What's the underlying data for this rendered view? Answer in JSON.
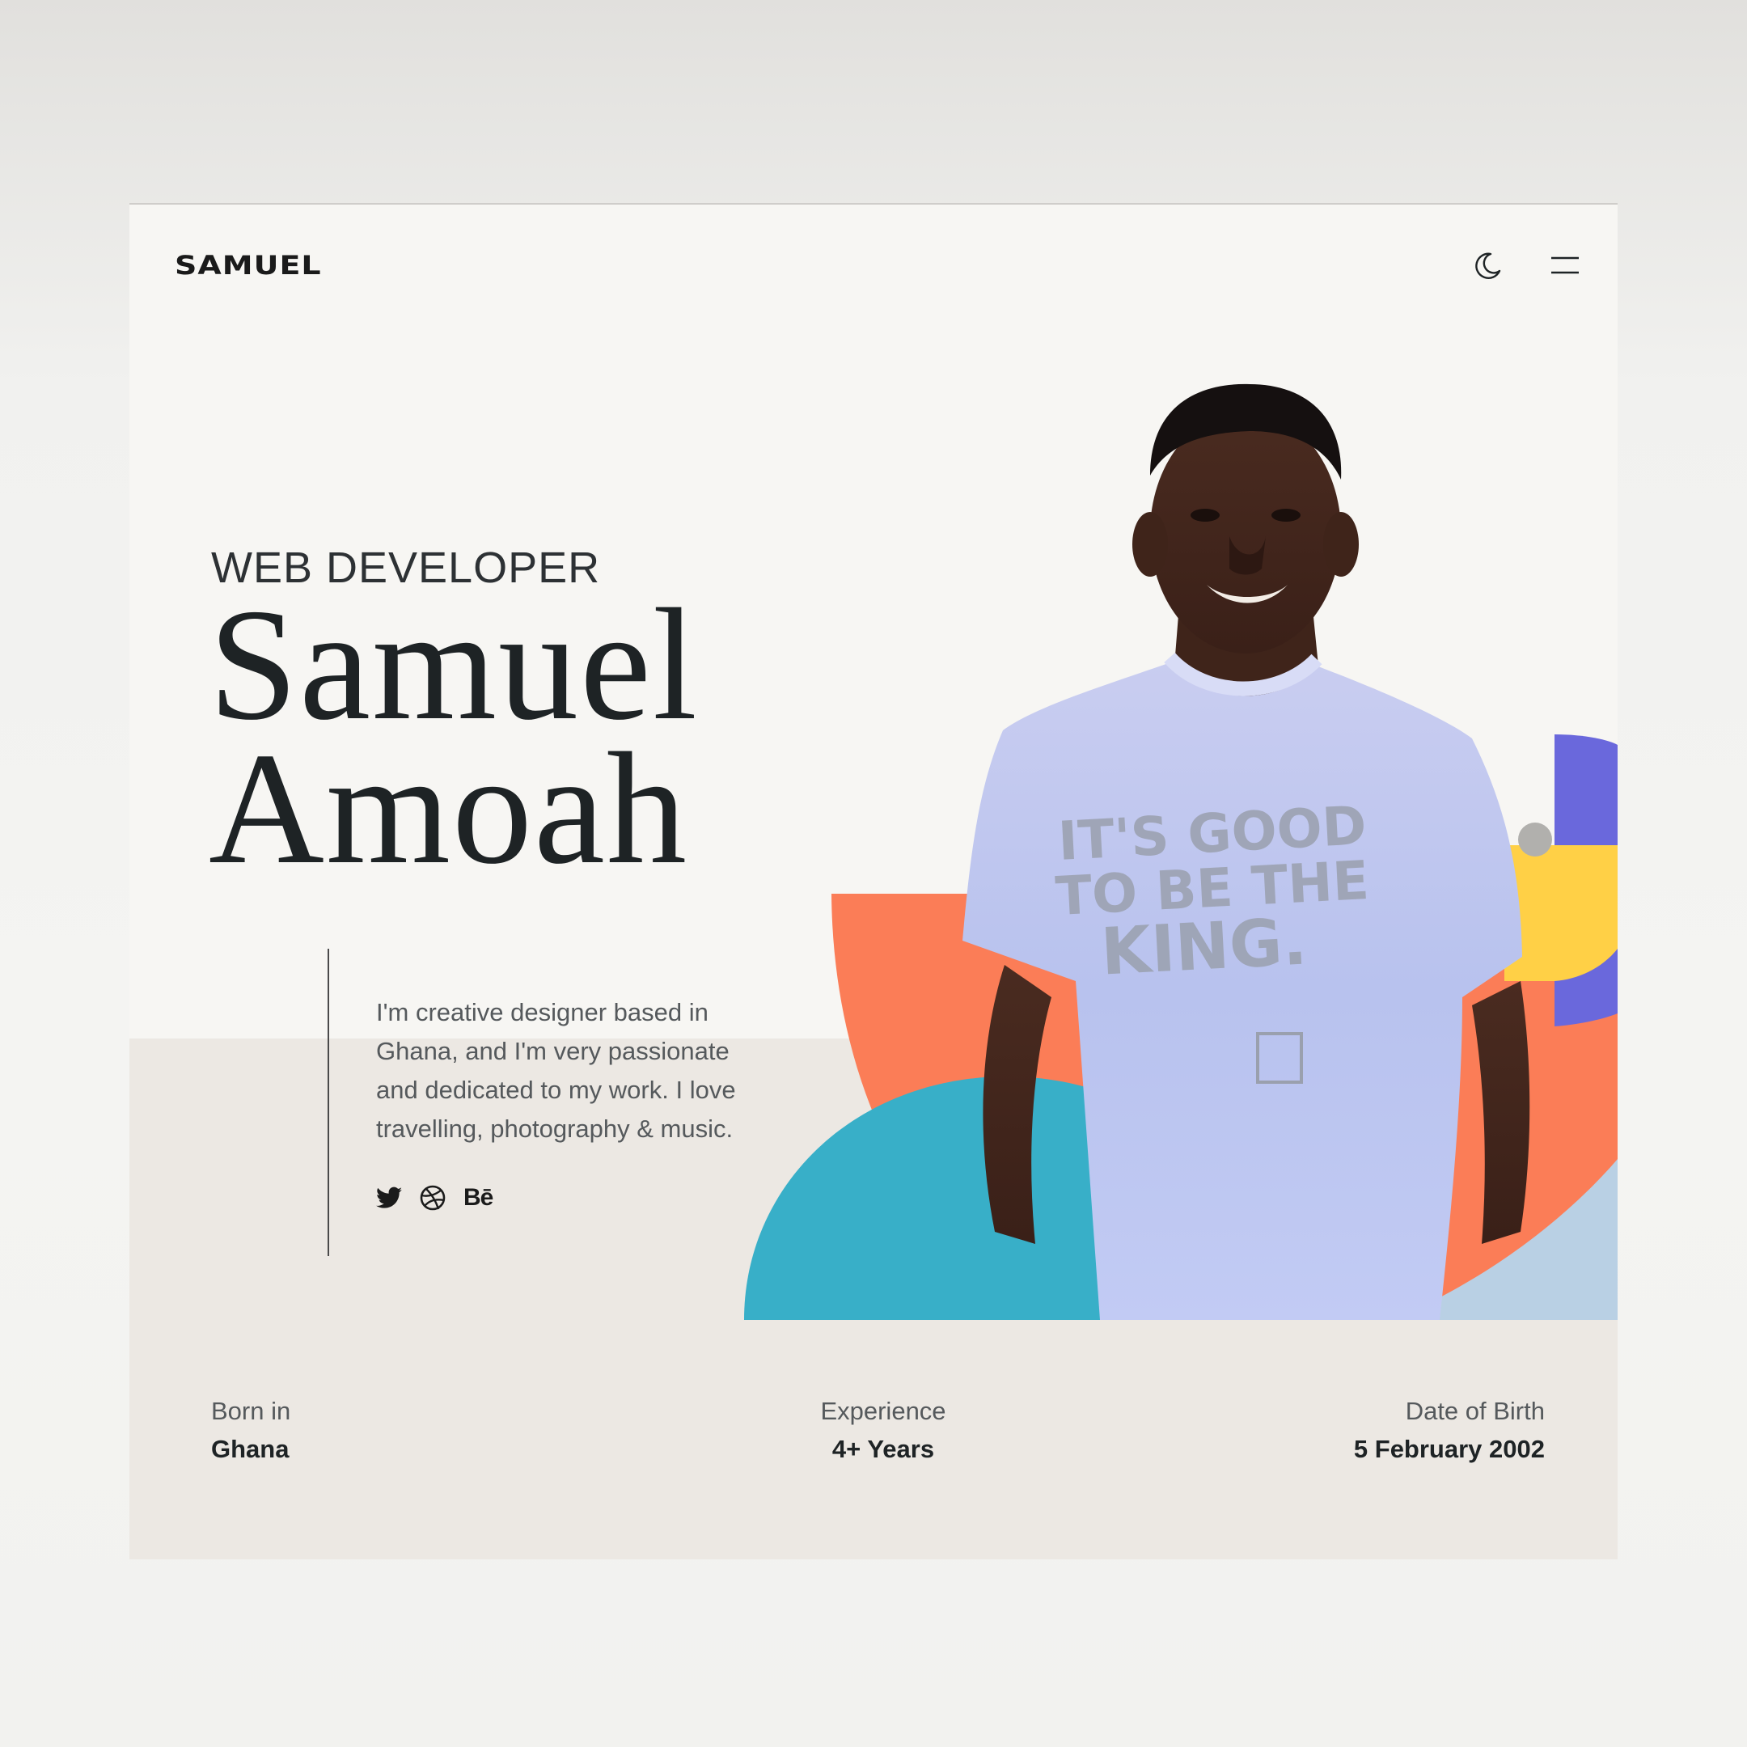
{
  "header": {
    "logo": "SAMUEL",
    "icons": [
      "moon-icon",
      "menu-icon"
    ]
  },
  "hero": {
    "role": "WEB DEVELOPER",
    "first_name": "Samuel",
    "last_name": "Amoah",
    "bio": "I'm creative designer based in Ghana, and I'm very passionate and dedicated to my work. I love travelling, photography & music.",
    "social": {
      "twitter_icon": "twitter-icon",
      "dribbble_icon": "dribbble-icon",
      "behance_label": "Bē"
    },
    "portrait_shirt_text": [
      "IT'S GOOD",
      "TO BE THE",
      "KING."
    ]
  },
  "stats": {
    "born": {
      "label": "Born in",
      "value": "Ghana"
    },
    "experience": {
      "label": "Experience",
      "value": "4+ Years"
    },
    "dob": {
      "label": "Date of Birth",
      "value": "5 February 2002"
    }
  },
  "colors": {
    "background": "#f7f6f3",
    "band": "#ece8e3",
    "orange": "#fb7d57",
    "teal": "#38afc8",
    "purple": "#6a68dc",
    "yellow": "#ffd046",
    "light_blue": "#b9d0e4",
    "ink": "#1e2325"
  }
}
